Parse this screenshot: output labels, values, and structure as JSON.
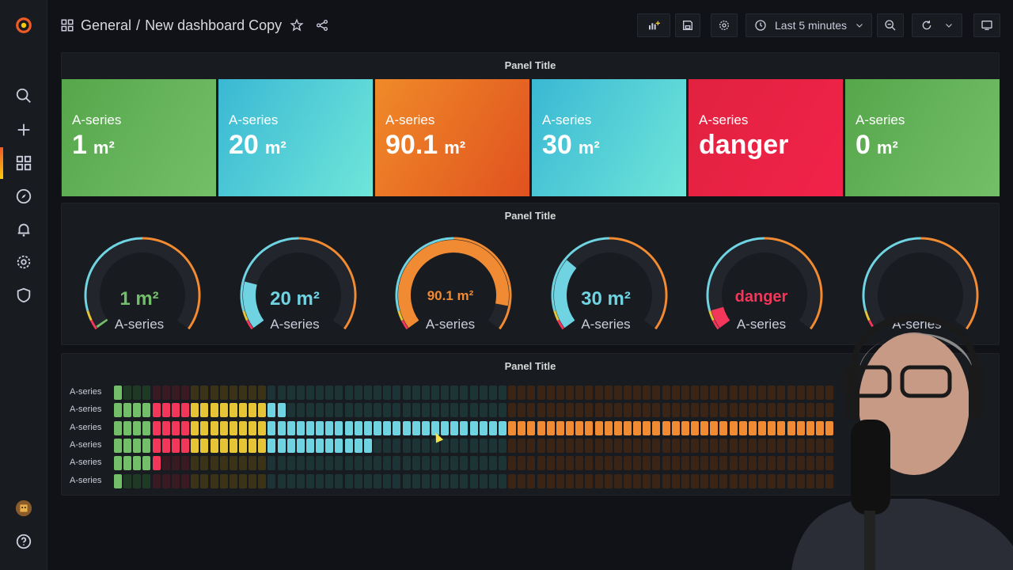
{
  "header": {
    "folder": "General",
    "separator": "/",
    "title": "New dashboard Copy",
    "time_range": "Last 5 minutes"
  },
  "sidebar": {
    "items": [
      "search-icon",
      "plus-icon",
      "dashboards-icon",
      "explore-icon",
      "alerting-icon",
      "configuration-icon",
      "shield-icon",
      "help-icon"
    ]
  },
  "stat_panel": {
    "title": "Panel Title",
    "tiles": [
      {
        "name": "A-series",
        "value": "1",
        "unit": "m²",
        "color_from": "#56a64b",
        "color_to": "#73bf69"
      },
      {
        "name": "A-series",
        "value": "20",
        "unit": "m²",
        "color_from": "#3ab8d4",
        "color_to": "#6fe6d9"
      },
      {
        "name": "A-series",
        "value": "90.1",
        "unit": "m²",
        "color_from": "#f08a29",
        "color_to": "#e0521f"
      },
      {
        "name": "A-series",
        "value": "30",
        "unit": "m²",
        "color_from": "#3ab8d4",
        "color_to": "#6fe6d9"
      },
      {
        "name": "A-series",
        "value": "danger",
        "unit": "",
        "color_from": "#e0223f",
        "color_to": "#f2224a"
      },
      {
        "name": "A-series",
        "value": "0",
        "unit": "m²",
        "color_from": "#56a64b",
        "color_to": "#73bf69"
      }
    ]
  },
  "gauge_panel": {
    "title": "Panel Title",
    "gauges": [
      {
        "name": "A-series",
        "value": "1 m²",
        "fraction": 0.01,
        "color": "#73bf69"
      },
      {
        "name": "A-series",
        "value": "20 m²",
        "fraction": 0.2,
        "color": "#6fd3e2"
      },
      {
        "name": "A-series",
        "value": "90.1 m²",
        "fraction": 0.901,
        "color": "#f08a33"
      },
      {
        "name": "A-series",
        "value": "30 m²",
        "fraction": 0.3,
        "color": "#6fd3e2"
      },
      {
        "name": "A-series",
        "value": "danger",
        "fraction": 0.08,
        "color": "#f2375b"
      },
      {
        "name": "A-series",
        "value": "",
        "fraction": 0.0,
        "color": "#73bf69"
      }
    ]
  },
  "bar_panel": {
    "title": "Panel Title",
    "rows": [
      {
        "name": "A-series",
        "lit": 1
      },
      {
        "name": "A-series",
        "lit": 18
      },
      {
        "name": "A-series",
        "lit": 75
      },
      {
        "name": "A-series",
        "lit": 27
      },
      {
        "name": "A-series",
        "lit": 5
      },
      {
        "name": "A-series",
        "lit": 1
      }
    ],
    "total_cells": 75,
    "zones": [
      {
        "until": 4,
        "on": "#73bf69",
        "off": "#1f3a24"
      },
      {
        "until": 8,
        "on": "#f2375b",
        "off": "#3a1a22"
      },
      {
        "until": 16,
        "on": "#e5c536",
        "off": "#3a3318"
      },
      {
        "until": 41,
        "on": "#6fd3e2",
        "off": "#1c3436"
      },
      {
        "until": 75,
        "on": "#f08a33",
        "off": "#3a2415"
      }
    ]
  },
  "colors": {
    "accent": "#f05a28",
    "background": "#111217",
    "panel": "#181b1f"
  }
}
